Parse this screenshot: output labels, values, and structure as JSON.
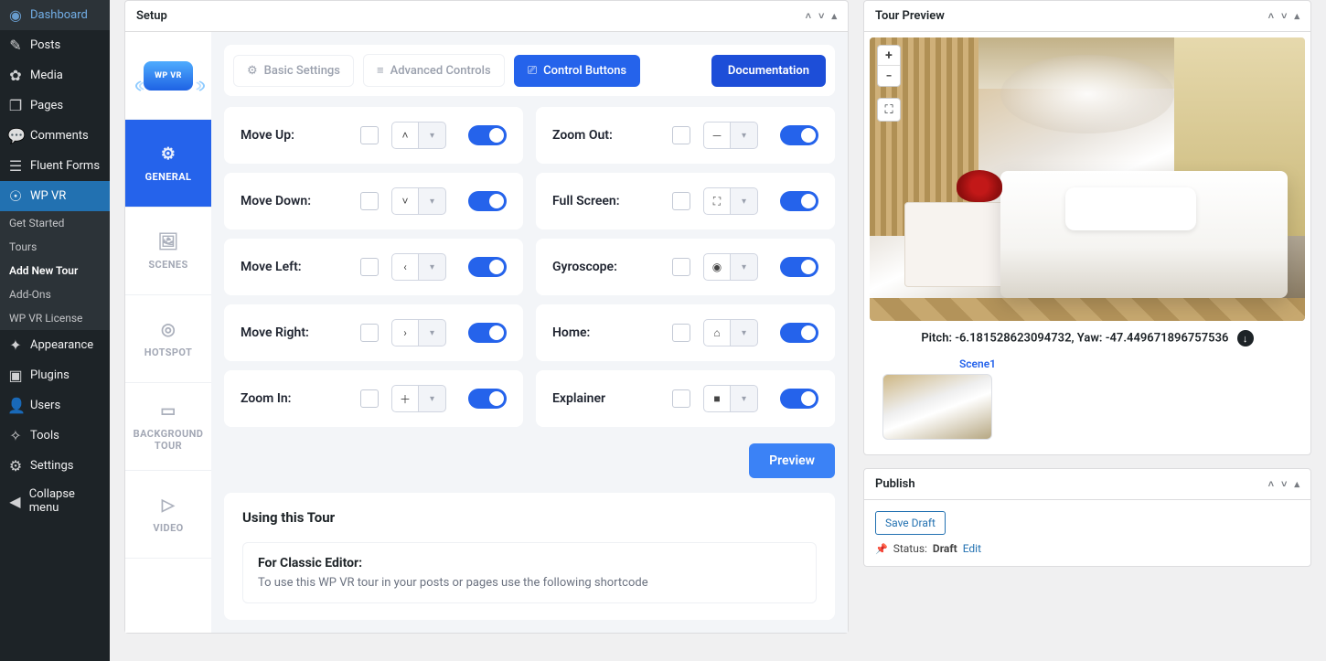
{
  "sidebar": {
    "items": [
      {
        "label": "Dashboard",
        "icon": "◉"
      },
      {
        "label": "Posts",
        "icon": "✎"
      },
      {
        "label": "Media",
        "icon": "✿"
      },
      {
        "label": "Pages",
        "icon": "❐"
      },
      {
        "label": "Comments",
        "icon": "💬"
      },
      {
        "label": "Fluent Forms",
        "icon": "☰"
      },
      {
        "label": "WP VR",
        "icon": "☉",
        "active": true
      }
    ],
    "submenu": [
      {
        "label": "Get Started"
      },
      {
        "label": "Tours"
      },
      {
        "label": "Add New Tour",
        "current": true
      },
      {
        "label": "Add-Ons"
      },
      {
        "label": "WP VR License"
      }
    ],
    "items_after": [
      {
        "label": "Appearance",
        "icon": "✦"
      },
      {
        "label": "Plugins",
        "icon": "▣"
      },
      {
        "label": "Users",
        "icon": "👤"
      },
      {
        "label": "Tools",
        "icon": "✧"
      },
      {
        "label": "Settings",
        "icon": "⚙"
      },
      {
        "label": "Collapse menu",
        "icon": "◀"
      }
    ]
  },
  "setup": {
    "title": "Setup",
    "logo_text": "WP VR",
    "vtabs": [
      {
        "label": "GENERAL",
        "icon": "⚙",
        "active": true
      },
      {
        "label": "SCENES",
        "icon": "🖼"
      },
      {
        "label": "HOTSPOT",
        "icon": "◎"
      },
      {
        "label": "BACKGROUND TOUR",
        "icon": "▭"
      },
      {
        "label": "VIDEO",
        "icon": "▷"
      }
    ],
    "subtabs": {
      "basic": {
        "label": "Basic Settings",
        "icon": "⚙"
      },
      "advanced": {
        "label": "Advanced Controls",
        "icon": "≡"
      },
      "control": {
        "label": "Control Buttons",
        "icon": "⎚"
      }
    },
    "doc_btn": "Documentation",
    "controls_left": [
      {
        "label": "Move Up:",
        "icon": "˄"
      },
      {
        "label": "Move Down:",
        "icon": "˅"
      },
      {
        "label": "Move Left:",
        "icon": "‹"
      },
      {
        "label": "Move Right:",
        "icon": "›"
      },
      {
        "label": "Zoom In:",
        "icon": "＋"
      }
    ],
    "controls_right": [
      {
        "label": "Zoom Out:",
        "icon": "－"
      },
      {
        "label": "Full Screen:",
        "icon": "⛶"
      },
      {
        "label": "Gyroscope:",
        "icon": "◉"
      },
      {
        "label": "Home:",
        "icon": "⌂"
      },
      {
        "label": "Explainer",
        "icon": "■"
      }
    ],
    "preview_btn": "Preview",
    "using": {
      "title": "Using this Tour",
      "classic_heading": "For Classic Editor:",
      "classic_text": "To use this WP VR tour in your posts or pages use the following shortcode"
    }
  },
  "tour_preview": {
    "title": "Tour Preview",
    "info": "Pitch: -6.181528623094732, Yaw: -47.449671896757536",
    "scene_label": "Scene1"
  },
  "publish": {
    "title": "Publish",
    "save_draft": "Save Draft",
    "status_label": "Status:",
    "status_value": "Draft",
    "edit": "Edit"
  }
}
